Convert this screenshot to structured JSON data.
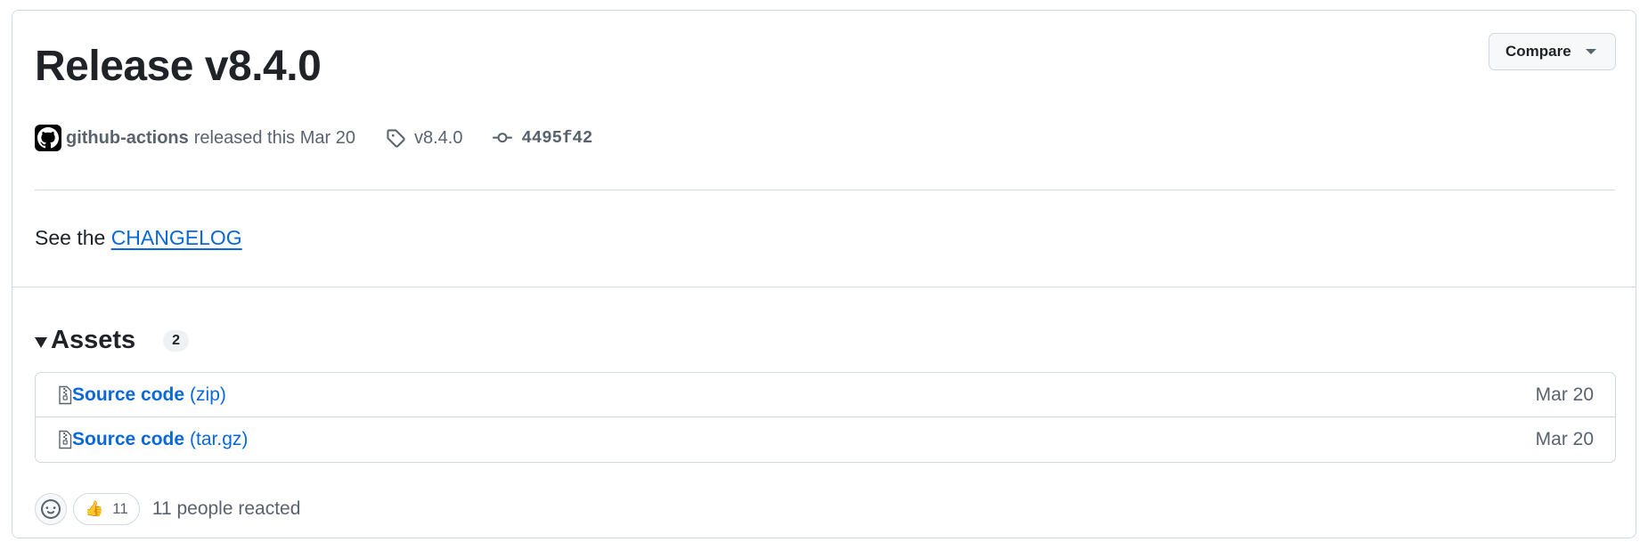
{
  "release": {
    "title": "Release v8.4.0",
    "compare_label": "Compare",
    "author": "github-actions",
    "released_text": "released this Mar 20",
    "tag": "v8.4.0",
    "commit": "4495f42",
    "body_prefix": "See the",
    "body_link": "CHANGELOG"
  },
  "assets": {
    "title": "Assets",
    "count": "2",
    "items": [
      {
        "name": "Source code",
        "ext": "(zip)",
        "date": "Mar 20",
        "icon": "file-zip-icon"
      },
      {
        "name": "Source code",
        "ext": "(tar.gz)",
        "date": "Mar 20",
        "icon": "file-zip-icon"
      }
    ]
  },
  "reactions": {
    "thumbs_emoji": "👍",
    "thumbs_count": "11",
    "summary": "11 people reacted"
  },
  "colors": {
    "link": "#0969da",
    "muted": "#59636e",
    "border": "#d1d9e0"
  }
}
